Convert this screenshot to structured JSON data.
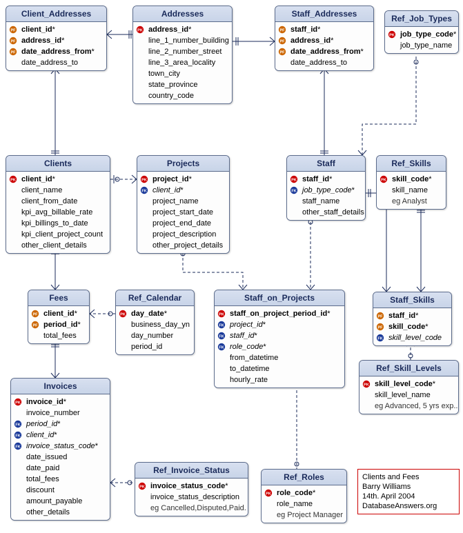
{
  "diagram_title": "Clients and Fees",
  "author": "Barry Williams",
  "date": "14th. April 2004",
  "source": "DatabaseAnswers.org",
  "entities": {
    "client_addresses": {
      "title": "Client_Addresses",
      "attrs": [
        {
          "k": "pf",
          "name": "client_id",
          "req": true
        },
        {
          "k": "pf",
          "name": "address_id",
          "req": true
        },
        {
          "k": "pf",
          "name": "date_address_from",
          "req": true
        },
        {
          "k": "",
          "name": "date_address_to",
          "req": false
        }
      ]
    },
    "addresses": {
      "title": "Addresses",
      "attrs": [
        {
          "k": "pk",
          "name": "address_id",
          "req": true
        },
        {
          "k": "",
          "name": "line_1_number_building",
          "req": false
        },
        {
          "k": "",
          "name": "line_2_number_street",
          "req": false
        },
        {
          "k": "",
          "name": "line_3_area_locality",
          "req": false
        },
        {
          "k": "",
          "name": "town_city",
          "req": false
        },
        {
          "k": "",
          "name": "state_province",
          "req": false
        },
        {
          "k": "",
          "name": "country_code",
          "req": false
        }
      ]
    },
    "staff_addresses": {
      "title": "Staff_Addresses",
      "attrs": [
        {
          "k": "pf",
          "name": "staff_id",
          "req": true
        },
        {
          "k": "pf",
          "name": "address_id",
          "req": true
        },
        {
          "k": "pf",
          "name": "date_address_from",
          "req": true
        },
        {
          "k": "",
          "name": "date_address_to",
          "req": false
        }
      ]
    },
    "ref_job_types": {
      "title": "Ref_Job_Types",
      "attrs": [
        {
          "k": "pk",
          "name": "job_type_code",
          "req": true
        },
        {
          "k": "",
          "name": "job_type_name",
          "req": false
        }
      ]
    },
    "clients": {
      "title": "Clients",
      "attrs": [
        {
          "k": "pk",
          "name": "client_id",
          "req": true
        },
        {
          "k": "",
          "name": "client_name",
          "req": false
        },
        {
          "k": "",
          "name": "client_from_date",
          "req": false
        },
        {
          "k": "",
          "name": "kpi_avg_billable_rate",
          "req": false
        },
        {
          "k": "",
          "name": "kpi_billings_to_date",
          "req": false
        },
        {
          "k": "",
          "name": "kpi_client_project_count",
          "req": false
        },
        {
          "k": "",
          "name": "other_client_details",
          "req": false
        }
      ]
    },
    "projects": {
      "title": "Projects",
      "attrs": [
        {
          "k": "pk",
          "name": "project_id",
          "req": true
        },
        {
          "k": "fk",
          "name": "client_id",
          "req": true
        },
        {
          "k": "",
          "name": "project_name",
          "req": false
        },
        {
          "k": "",
          "name": "project_start_date",
          "req": false
        },
        {
          "k": "",
          "name": "project_end_date",
          "req": false
        },
        {
          "k": "",
          "name": "project_description",
          "req": false
        },
        {
          "k": "",
          "name": "other_project_details",
          "req": false
        }
      ]
    },
    "staff": {
      "title": "Staff",
      "attrs": [
        {
          "k": "pk",
          "name": "staff_id",
          "req": true
        },
        {
          "k": "fk",
          "name": "job_type_code",
          "req": true
        },
        {
          "k": "",
          "name": "staff_name",
          "req": false
        },
        {
          "k": "",
          "name": "other_staff_details",
          "req": false
        }
      ]
    },
    "ref_skills": {
      "title": "Ref_Skills",
      "attrs": [
        {
          "k": "pk",
          "name": "skill_code",
          "req": true
        },
        {
          "k": "",
          "name": "skill_name",
          "req": false
        },
        {
          "k": "",
          "name": "eg Analyst",
          "req": false,
          "note": true
        }
      ]
    },
    "fees": {
      "title": "Fees",
      "attrs": [
        {
          "k": "pf",
          "name": "client_id",
          "req": true
        },
        {
          "k": "pf",
          "name": "period_id",
          "req": true
        },
        {
          "k": "",
          "name": "total_fees",
          "req": false
        }
      ]
    },
    "ref_calendar": {
      "title": "Ref_Calendar",
      "attrs": [
        {
          "k": "pk",
          "name": "day_date",
          "req": true
        },
        {
          "k": "",
          "name": "business_day_yn",
          "req": false
        },
        {
          "k": "",
          "name": "day_number",
          "req": false
        },
        {
          "k": "",
          "name": "period_id",
          "req": false
        }
      ]
    },
    "staff_on_projects": {
      "title": "Staff_on_Projects",
      "attrs": [
        {
          "k": "pk",
          "name": "staff_on_project_period_id",
          "req": true
        },
        {
          "k": "fk",
          "name": "project_id",
          "req": true
        },
        {
          "k": "fk",
          "name": "staff_id",
          "req": true
        },
        {
          "k": "fk",
          "name": "role_code",
          "req": true
        },
        {
          "k": "",
          "name": "from_datetime",
          "req": false
        },
        {
          "k": "",
          "name": "to_datetime",
          "req": false
        },
        {
          "k": "",
          "name": "hourly_rate",
          "req": false
        }
      ]
    },
    "staff_skills": {
      "title": "Staff_Skills",
      "attrs": [
        {
          "k": "pf",
          "name": "staff_id",
          "req": true
        },
        {
          "k": "pf",
          "name": "skill_code",
          "req": true
        },
        {
          "k": "fk",
          "name": "skill_level_code",
          "req": false
        }
      ]
    },
    "ref_skill_levels": {
      "title": "Ref_Skill_Levels",
      "attrs": [
        {
          "k": "pk",
          "name": "skill_level_code",
          "req": true
        },
        {
          "k": "",
          "name": "skill_level_name",
          "req": false
        },
        {
          "k": "",
          "name": "eg Advanced, 5 yrs exp..",
          "req": false,
          "note": true
        }
      ]
    },
    "invoices": {
      "title": "Invoices",
      "attrs": [
        {
          "k": "pk",
          "name": "invoice_id",
          "req": true
        },
        {
          "k": "",
          "name": "invoice_number",
          "req": false
        },
        {
          "k": "fk",
          "name": "period_id",
          "req": true
        },
        {
          "k": "fk",
          "name": "client_id",
          "req": true
        },
        {
          "k": "fk",
          "name": "invoice_status_code",
          "req": true
        },
        {
          "k": "",
          "name": "date_issued",
          "req": false
        },
        {
          "k": "",
          "name": "date_paid",
          "req": false
        },
        {
          "k": "",
          "name": "total_fees",
          "req": false
        },
        {
          "k": "",
          "name": "discount",
          "req": false
        },
        {
          "k": "",
          "name": "amount_payable",
          "req": false
        },
        {
          "k": "",
          "name": "other_details",
          "req": false
        }
      ]
    },
    "ref_invoice_status": {
      "title": "Ref_Invoice_Status",
      "attrs": [
        {
          "k": "pk",
          "name": "invoice_status_code",
          "req": true
        },
        {
          "k": "",
          "name": "invoice_status_description",
          "req": false
        },
        {
          "k": "",
          "name": "eg Cancelled,Disputed,Paid.",
          "req": false,
          "note": true
        }
      ]
    },
    "ref_roles": {
      "title": "Ref_Roles",
      "attrs": [
        {
          "k": "pk",
          "name": "role_code",
          "req": true
        },
        {
          "k": "",
          "name": "role_name",
          "req": false
        },
        {
          "k": "",
          "name": "eg Project Manager",
          "req": false,
          "note": true
        }
      ]
    }
  }
}
